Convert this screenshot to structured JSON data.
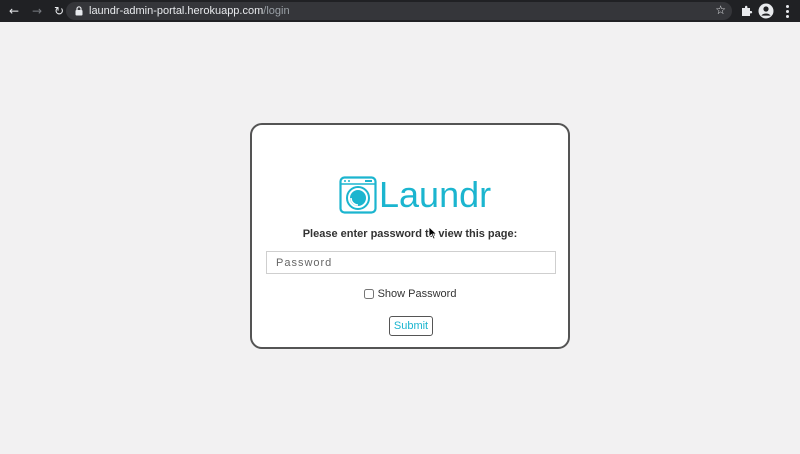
{
  "browser": {
    "back_icon": "arrow-left-icon",
    "forward_icon": "arrow-right-icon",
    "reload_icon": "reload-icon",
    "url_host": "laundr-admin-portal.herokuapp.com",
    "url_path": "/login",
    "bookmark_icon": "star-icon",
    "extensions_icon": "puzzle-icon",
    "profile_icon": "account-icon",
    "menu_icon": "kebab-menu-icon"
  },
  "login": {
    "logo_text": "Laundr",
    "prompt": "Please enter password to view this page:",
    "password_placeholder": "Password",
    "password_value": "",
    "show_password_label": "Show Password",
    "show_password_checked": false,
    "submit_label": "Submit"
  },
  "colors": {
    "brand": "#1bb5cf",
    "page_background": "#f2f1f2",
    "card_border": "#545454"
  }
}
